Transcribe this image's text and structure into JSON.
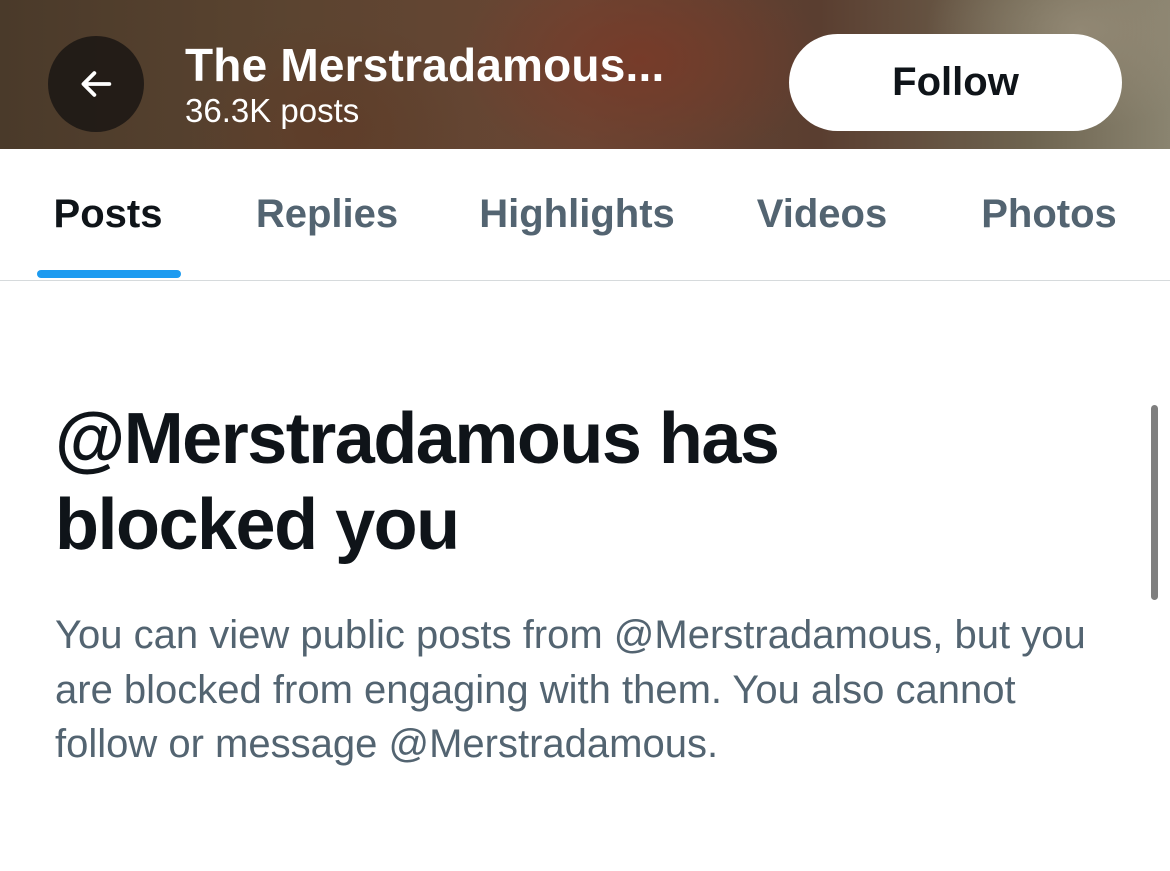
{
  "header": {
    "profile_name": "The Merstradamous...",
    "post_count": "36.3K posts",
    "follow_label": "Follow",
    "back_icon": "arrow-left-icon"
  },
  "tabs": [
    {
      "label": "Posts",
      "active": true
    },
    {
      "label": "Replies",
      "active": false
    },
    {
      "label": "Highlights",
      "active": false
    },
    {
      "label": "Videos",
      "active": false
    },
    {
      "label": "Photos",
      "active": false
    }
  ],
  "blocked": {
    "title": "@Merstradamous has blocked you",
    "description": "You can view public posts from @Merstradamous, but you are blocked from engaging with them. You also cannot follow or message @Merstradamous."
  },
  "colors": {
    "accent": "#1d9bf0",
    "text_primary": "#0f1419",
    "text_secondary": "#536471"
  }
}
